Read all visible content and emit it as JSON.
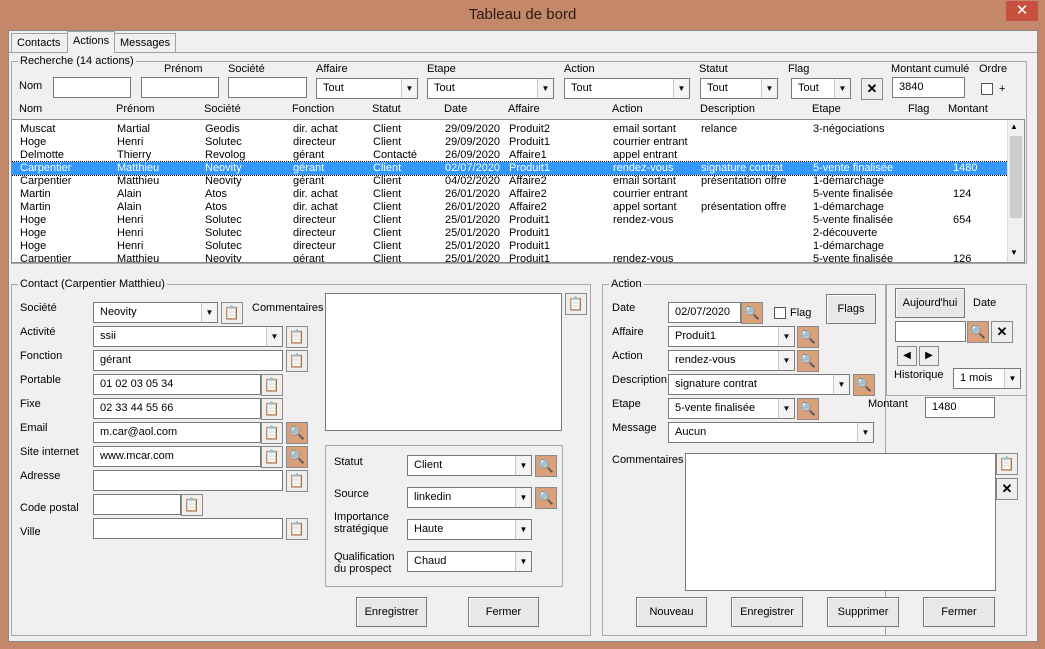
{
  "window": {
    "title": "Tableau de bord",
    "close": "✕"
  },
  "tabs": [
    {
      "label": "Contacts"
    },
    {
      "label": "Actions"
    },
    {
      "label": "Messages"
    }
  ],
  "search": {
    "frame_title": "Recherche (14 actions)",
    "nom_label": "Nom",
    "prenom_label": "Prénom",
    "societe_label": "Société",
    "affaire_label": "Affaire",
    "affaire_value": "Tout",
    "etape_label": "Etape",
    "etape_value": "Tout",
    "action_label": "Action",
    "action_value": "Tout",
    "statut_label": "Statut",
    "statut_value": "Tout",
    "flag_label": "Flag",
    "flag_value": "Tout",
    "clear": "✕",
    "montant_label": "Montant cumulé",
    "montant_value": "3840",
    "ordre_label": "Ordre",
    "ordre_plus": "+"
  },
  "list": {
    "headers": [
      "Nom",
      "Prénom",
      "Société",
      "Fonction",
      "Statut",
      "Date",
      "Affaire",
      "Action",
      "Description",
      "Etape",
      "Flag",
      "Montant"
    ],
    "rows": [
      [
        "Muscat",
        "Martial",
        "Geodis",
        "dir. achat",
        "Client",
        "29/09/2020",
        "Produit2",
        "email sortant",
        "relance",
        "3-négociations",
        "",
        ""
      ],
      [
        "Hoge",
        "Henri",
        "Solutec",
        "directeur",
        "Client",
        "29/09/2020",
        "Produit1",
        "courrier entrant",
        "",
        "",
        "",
        ""
      ],
      [
        "Delmotte",
        "Thierry",
        "Revolog",
        "gérant",
        "Contacté",
        "26/09/2020",
        "Affaire1",
        "appel entrant",
        "",
        "",
        "",
        ""
      ],
      [
        "Carpentier",
        "Matthieu",
        "Neovity",
        "gérant",
        "Client",
        "02/07/2020",
        "Produit1",
        "rendez-vous",
        "signature contrat",
        "5-vente finalisée",
        "",
        "1480"
      ],
      [
        "Carpentier",
        "Matthieu",
        "Neovity",
        "gérant",
        "Client",
        "04/02/2020",
        "Affaire2",
        "email sortant",
        "présentation offre",
        "1-démarchage",
        "",
        ""
      ],
      [
        "Martin",
        "Alain",
        "Atos",
        "dir. achat",
        "Client",
        "26/01/2020",
        "Affaire2",
        "courrier entrant",
        "",
        "5-vente finalisée",
        "",
        "124"
      ],
      [
        "Martin",
        "Alain",
        "Atos",
        "dir. achat",
        "Client",
        "26/01/2020",
        "Affaire2",
        "appel sortant",
        "présentation offre",
        "1-démarchage",
        "",
        ""
      ],
      [
        "Hoge",
        "Henri",
        "Solutec",
        "directeur",
        "Client",
        "25/01/2020",
        "Produit1",
        "rendez-vous",
        "",
        "5-vente finalisée",
        "",
        "654"
      ],
      [
        "Hoge",
        "Henri",
        "Solutec",
        "directeur",
        "Client",
        "25/01/2020",
        "Produit1",
        "",
        "",
        "2-découverte",
        "",
        ""
      ],
      [
        "Hoge",
        "Henri",
        "Solutec",
        "directeur",
        "Client",
        "25/01/2020",
        "Produit1",
        "",
        "",
        "1-démarchage",
        "",
        ""
      ],
      [
        "Carpentier",
        "Matthieu",
        "Neovity",
        "gérant",
        "Client",
        "25/01/2020",
        "Produit1",
        "rendez-vous",
        "",
        "5-vente finalisée",
        "",
        "126"
      ]
    ],
    "selected_row": 3
  },
  "contact": {
    "frame_title": "Contact (Carpentier Matthieu)",
    "societe_label": "Société",
    "societe_value": "Neovity",
    "commentaires_label": "Commentaires",
    "activite_label": "Activité",
    "activite_value": "ssii",
    "fonction_label": "Fonction",
    "fonction_value": "gérant",
    "portable_label": "Portable",
    "portable_value": "01 02 03 05 34",
    "fixe_label": "Fixe",
    "fixe_value": "02 33 44 55 66",
    "email_label": "Email",
    "email_value": "m.car@aol.com",
    "site_label": "Site internet",
    "site_value": "www.mcar.com",
    "adresse_label": "Adresse",
    "adresse_value": "",
    "cp_label": "Code postal",
    "cp_value": "",
    "ville_label": "Ville",
    "ville_value": "",
    "statut_label": "Statut",
    "statut_value": "Client",
    "source_label": "Source",
    "source_value": "linkedin",
    "importance_label1": "Importance",
    "importance_label2": "stratégique",
    "importance_value": "Haute",
    "qualif_label1": "Qualification",
    "qualif_label2": "du prospect",
    "qualif_value": "Chaud",
    "save": "Enregistrer",
    "close": "Fermer"
  },
  "action": {
    "frame_title": "Action",
    "date_label": "Date",
    "date_value": "02/07/2020",
    "flag_label": "Flag",
    "flags_button": "Flags",
    "affaire_label": "Affaire",
    "affaire_value": "Produit1",
    "action_label": "Action",
    "action_value": "rendez-vous",
    "description_label": "Description",
    "description_value": "signature contrat",
    "etape_label": "Etape",
    "etape_value": "5-vente finalisée",
    "montant_label": "Montant",
    "montant_value": "1480",
    "message_label": "Message",
    "message_value": "Aucun",
    "commentaires_label": "Commentaires",
    "new": "Nouveau",
    "save": "Enregistrer",
    "delete": "Supprimer",
    "close": "Fermer"
  },
  "side": {
    "today": "Aujourd'hui",
    "date_label": "Date",
    "prev": "◀",
    "next": "▶",
    "historique_label": "Historique",
    "historique_value": "1 mois",
    "clear": "✕"
  },
  "icons": {
    "copy": "clipboard-icon",
    "search": "search-icon",
    "dropdown": "chevron-down-icon"
  }
}
